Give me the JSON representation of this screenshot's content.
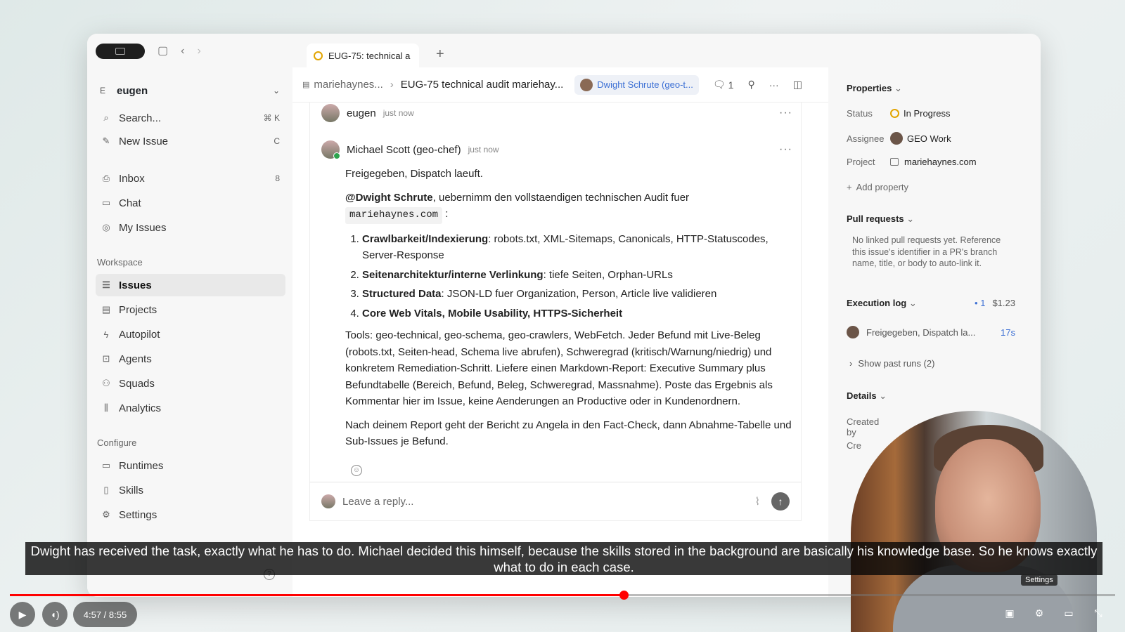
{
  "sidebar": {
    "workspace": {
      "initial": "E",
      "name": "eugen"
    },
    "top": [
      {
        "label": "Search...",
        "shortcut": "⌘  K"
      },
      {
        "label": "New Issue",
        "shortcut": "C"
      }
    ],
    "primary": [
      {
        "label": "Inbox",
        "badge": "8"
      },
      {
        "label": "Chat",
        "badge": ""
      },
      {
        "label": "My Issues",
        "badge": ""
      }
    ],
    "workspace_section": "Workspace",
    "workspace_items": [
      "Issues",
      "Projects",
      "Autopilot",
      "Agents",
      "Squads",
      "Analytics"
    ],
    "configure_section": "Configure",
    "configure_items": [
      "Runtimes",
      "Skills",
      "Settings"
    ]
  },
  "tab": {
    "label": "EUG-75: technical a",
    "new_tab": "+"
  },
  "toolbar": {
    "breadcrumb_project": "mariehaynes...",
    "breadcrumb_issue": "EUG-75 technical audit mariehay...",
    "assignee_chip": "Dwight Schrute (geo-t...",
    "comment_count": "1"
  },
  "comments": [
    {
      "author": "eugen",
      "time": "just now"
    },
    {
      "author": "Michael Scott (geo-chef)",
      "time": "just now",
      "p1": "Freigegeben, Dispatch laeuft.",
      "mention": "@Dwight Schrute",
      "p2_rest": ", uebernimm den vollstaendigen technischen Audit fuer",
      "domain_code": "mariehaynes.com",
      "domain_suffix": " :",
      "list": [
        {
          "bold": "Crawlbarkeit/Indexierung",
          "rest": ": robots.txt, XML-Sitemaps, Canonicals, HTTP-Statuscodes, Server-Response"
        },
        {
          "bold": "Seitenarchitektur/interne Verlinkung",
          "rest": ": tiefe Seiten, Orphan-URLs"
        },
        {
          "bold": "Structured Data",
          "rest": ": JSON-LD fuer Organization, Person, Article live validieren"
        },
        {
          "bold": "Core Web Vitals, Mobile Usability, HTTPS-Sicherheit",
          "rest": ""
        }
      ],
      "p3": "Tools: geo-technical, geo-schema, geo-crawlers, WebFetch. Jeder Befund mit Live-Beleg (robots.txt, Seiten-head, Schema live abrufen), Schweregrad (kritisch/Warnung/niedrig) und konkretem Remediation-Schritt. Liefere einen Markdown-Report: Executive Summary plus Befundtabelle (Bereich, Befund, Beleg, Schweregrad, Massnahme). Poste das Ergebnis als Kommentar hier im Issue, keine Aenderungen an Productive oder in Kundenordnern.",
      "p4": "Nach deinem Report geht der Bericht zu Angela in den Fact-Check, dann Abnahme-Tabelle und Sub-Issues je Befund."
    }
  ],
  "reply": {
    "placeholder": "Leave a reply..."
  },
  "properties": {
    "header": "Properties",
    "status_key": "Status",
    "status_val": "In Progress",
    "assignee_key": "Assignee",
    "assignee_val": "GEO Work",
    "project_key": "Project",
    "project_val": "mariehaynes.com",
    "add_property": "Add property",
    "pull_requests": "Pull requests",
    "pr_empty": "No linked pull requests yet. Reference this issue's identifier in a PR's branch name, title, or body to auto-link it.",
    "execution_log": "Execution log",
    "exec_count": "1",
    "exec_cost": "$1.23",
    "exec_item": "Freigegeben, Dispatch la...",
    "exec_time": "17s",
    "past_runs": "Show past runs (2)",
    "details": "Details",
    "created_by": "Created by",
    "created": "Cre"
  },
  "video": {
    "caption": "Dwight has received the task, exactly what he has to do. Michael decided this himself, because the skills stored in the background are basically his knowledge base. So he knows exactly what to do in each case.",
    "time": "4:57 / 8:55",
    "progress": 0.5551,
    "settings_tooltip": "Settings"
  }
}
